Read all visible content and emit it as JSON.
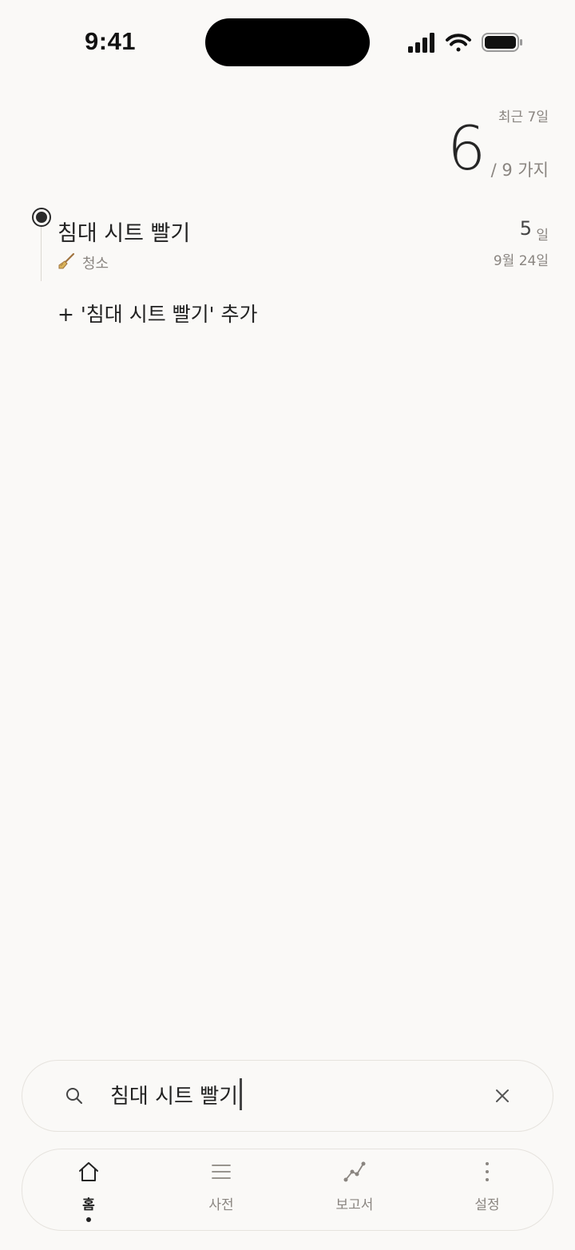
{
  "status_bar": {
    "time": "9:41"
  },
  "summary": {
    "period_label": "최근 7일",
    "count": "6",
    "total": "/ 9 가지"
  },
  "item": {
    "title": "침대 시트 빨기",
    "category_icon": "broom-icon",
    "category": "청소",
    "days_number": "5",
    "days_unit": "일",
    "date": "9월 24일"
  },
  "add_link": "+ '침대 시트 빨기' 추가",
  "search": {
    "value": "침대 시트 빨기"
  },
  "tabs": [
    {
      "label": "홈",
      "icon": "home-icon",
      "active": true
    },
    {
      "label": "사전",
      "icon": "list-icon",
      "active": false
    },
    {
      "label": "보고서",
      "icon": "chart-line-icon",
      "active": false
    },
    {
      "label": "설정",
      "icon": "more-vertical-icon",
      "active": false
    }
  ],
  "colors": {
    "background": "#faf9f7",
    "text": "#222222",
    "muted": "#8a8580"
  }
}
